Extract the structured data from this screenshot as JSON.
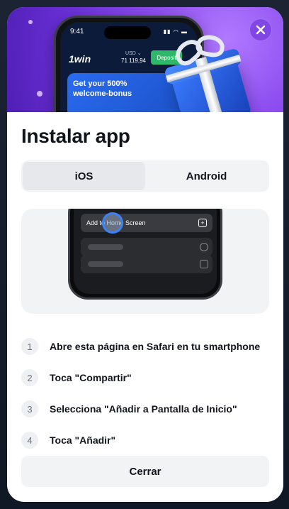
{
  "hero": {
    "phone_time": "9:41",
    "currency": "USD ⌄",
    "balance": "71 119,94",
    "deposit_label": "Deposit",
    "brand": "1win",
    "banner_text": "Get your 500% welcome-bonus"
  },
  "modal": {
    "title": "Instalar app",
    "tabs": [
      {
        "label": "iOS",
        "active": true
      },
      {
        "label": "Android",
        "active": false
      }
    ],
    "preview": {
      "menu_item": "Add to Home Screen"
    },
    "steps": [
      {
        "num": "1",
        "text": "Abre esta página en Safari en tu smartphone"
      },
      {
        "num": "2",
        "text": "Toca \"Compartir\""
      },
      {
        "num": "3",
        "text": "Selecciona \"Añadir a Pantalla de Inicio\""
      },
      {
        "num": "4",
        "text": "Toca \"Añadir\""
      }
    ],
    "close_button": "Cerrar"
  },
  "colors": {
    "accent_purple": "#8d4df0",
    "deposit_green": "#2fb86a",
    "tap_blue": "#3b82f6"
  },
  "icons": [
    "close-icon",
    "plus-square-icon",
    "gift-icon"
  ]
}
